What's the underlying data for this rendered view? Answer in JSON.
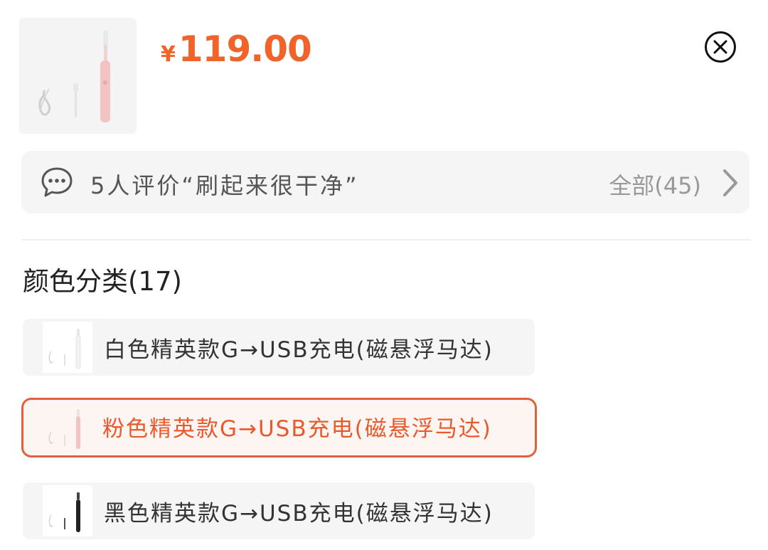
{
  "product": {
    "thumbnail_icon": "electric-toothbrush-pink",
    "currency": "¥",
    "price": "119.00",
    "price_color": "#f0632a"
  },
  "header": {
    "close_icon": "close-circle-icon"
  },
  "reviews": {
    "icon": "comment-bubble-icon",
    "summary": "5人评价“刷起来很干净”",
    "all_label": "全部(45)",
    "chevron_icon": "chevron-right-icon"
  },
  "color_section": {
    "title": "颜色分类(17)",
    "selected_index": 1,
    "accent_color": "#e0623a",
    "options": [
      {
        "label": "白色精英款G→USB充电(磁悬浮马达)",
        "thumb_color": "#f2f2f2"
      },
      {
        "label": "粉色精英款G→USB充电(磁悬浮马达)",
        "thumb_color": "#f3c3c1"
      },
      {
        "label": "黑色精英款G→USB充电(磁悬浮马达)",
        "thumb_color": "#222222"
      }
    ]
  }
}
